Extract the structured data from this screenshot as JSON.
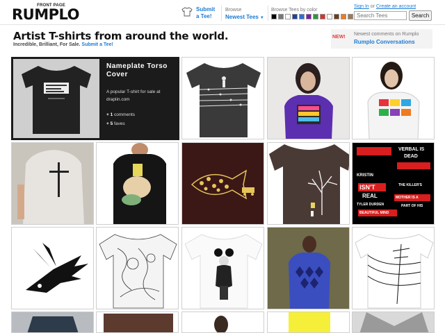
{
  "header": {
    "logo_small": "FRONT PAGE",
    "logo_main": "RUMPLO",
    "submit_line1": "Submit",
    "submit_line2": "a Tee!",
    "browse_label": "Browse",
    "browse_value": "Newest Tees",
    "color_label": "Browse Tees by color",
    "colors": [
      "#000000",
      "#777777",
      "#ffffff",
      "#1f3f9a",
      "#2d6fd6",
      "#7a1fa8",
      "#2c9a3b",
      "#d6342a",
      "#ffffff",
      "#6b3d1b",
      "#f07a1e",
      "#9b7b5a"
    ],
    "sign_in": "Sign In",
    "or": "or",
    "create_account": "Create an account",
    "search_placeholder": "Search Tees",
    "search_button": "Search"
  },
  "banner": {
    "headline": "Artist T-shirts from around the world.",
    "tagline": "Incredible, Brilliant, For Sale.",
    "tagline_link": "Submit a Tee!",
    "new_badge": "NEW!",
    "comments_label": "Newest comments on Rumplo",
    "comments_link": "Rumplo Conversations"
  },
  "featured": {
    "title": "Nameplate Torso Cover",
    "description": "A popular T-shirt for sale at draplin.com",
    "comments_count": "+ 1",
    "comments_label": "comments",
    "faves_count": "+ 5",
    "faves_label": "faves"
  },
  "grid": {
    "text_tee_lines": [
      "VERBAL IS",
      "DEAD",
      "KRISTIN",
      "ISN'T",
      "REAL",
      "TYLER DURDEN",
      "THE KILLER'S",
      "MOTHER IS A",
      "PART OF HIS",
      "BEAUTIFUL MIND"
    ]
  }
}
